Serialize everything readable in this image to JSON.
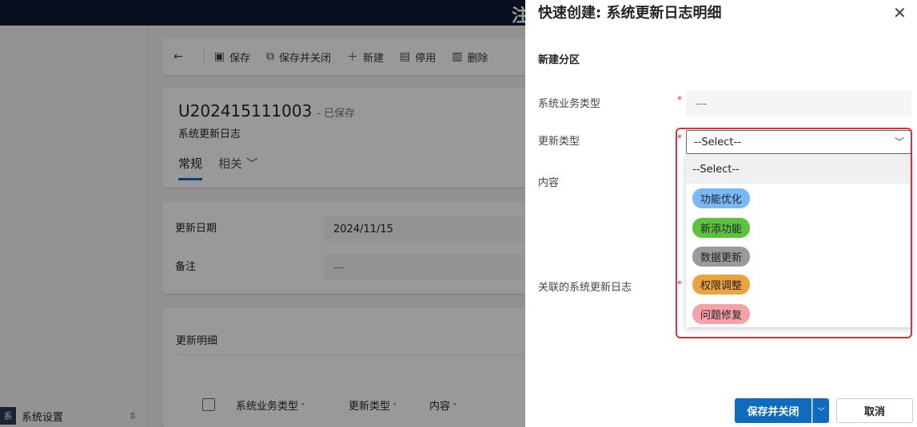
{
  "topbar": {
    "glyph": "注"
  },
  "area": {
    "badge": "系",
    "label": "系统设置"
  },
  "commandbar": {
    "back_icon": "arrow-left-icon",
    "save": "保存",
    "save_close": "保存并关闭",
    "new": "新建",
    "deactivate": "停用",
    "delete": "删除"
  },
  "record": {
    "title": "U202415111003",
    "saved_status": "- 已保存",
    "entity": "系统更新日志",
    "tabs": [
      "常规",
      "相关"
    ]
  },
  "form": {
    "date_label": "更新日期",
    "date_value": "2024/11/15",
    "note_label": "备注",
    "note_value": "---"
  },
  "subgrid": {
    "title": "更新明细",
    "columns": [
      "系统业务类型",
      "更新类型",
      "内容"
    ]
  },
  "quick_create": {
    "title": "快速创建: 系统更新日志明细",
    "section": "新建分区",
    "fields": {
      "biz_type_label": "系统业务类型",
      "biz_type_value": "---",
      "update_type_label": "更新类型",
      "update_type_value": "--Select--",
      "content_label": "内容",
      "related_log_label": "关联的系统更新日志"
    },
    "required_marker": "*",
    "options": [
      {
        "label": "--Select--",
        "color": ""
      },
      {
        "label": "功能优化",
        "color": "#7ab8f5"
      },
      {
        "label": "新添功能",
        "color": "#5cc43c"
      },
      {
        "label": "数据更新",
        "color": "#9a9a9a"
      },
      {
        "label": "权限调整",
        "color": "#eaa43d"
      },
      {
        "label": "问题修复",
        "color": "#f5a3a8"
      }
    ],
    "save_close": "保存并关闭",
    "cancel": "取消"
  },
  "colors": {
    "accent": "#0f6cbd",
    "highlight": "#d9303e"
  }
}
